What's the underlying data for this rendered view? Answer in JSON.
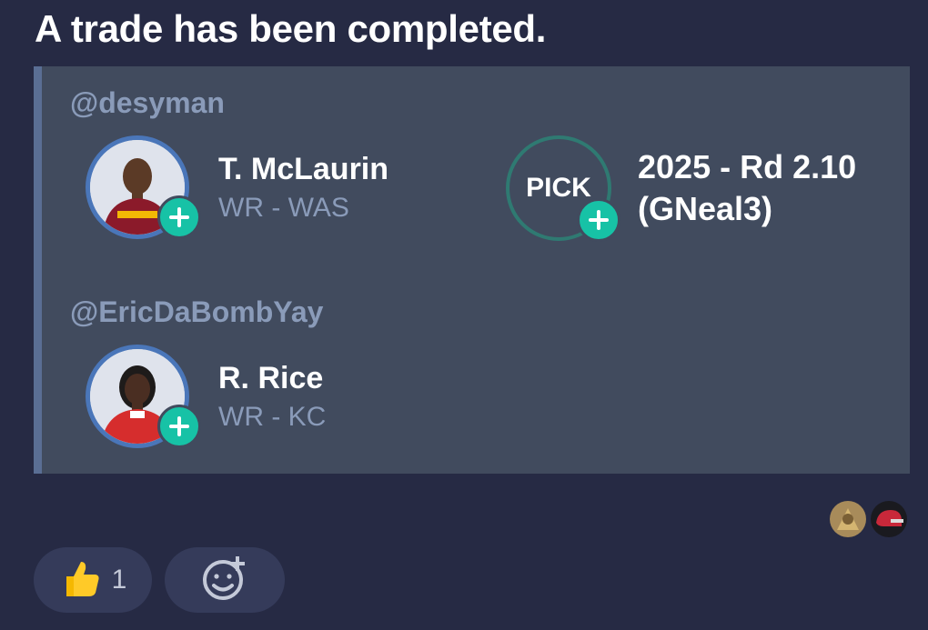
{
  "message": {
    "title": "A trade has been completed."
  },
  "trade": {
    "side1": {
      "user": "@desyman",
      "player": {
        "name": "T. McLaurin",
        "position": "WR - WAS"
      },
      "pick": {
        "badge": "PICK",
        "line1": "2025 - Rd 2.10",
        "line2": "(GNeal3)"
      }
    },
    "side2": {
      "user": "@EricDaBombYay",
      "player": {
        "name": "R. Rice",
        "position": "WR - KC"
      }
    }
  },
  "reactions": {
    "thumbs_up": {
      "icon": "thumbs-up-emoji",
      "count": "1"
    },
    "add_reaction": {
      "icon": "add-emoji-icon"
    }
  },
  "colors": {
    "background": "#262a44",
    "card": "#414b5e",
    "card_border": "#5a6e94",
    "accent_add": "#17c2a6",
    "avatar_ring": "#4a76b9",
    "pick_ring": "#2f7a72",
    "muted_text": "#8a9bb9"
  }
}
